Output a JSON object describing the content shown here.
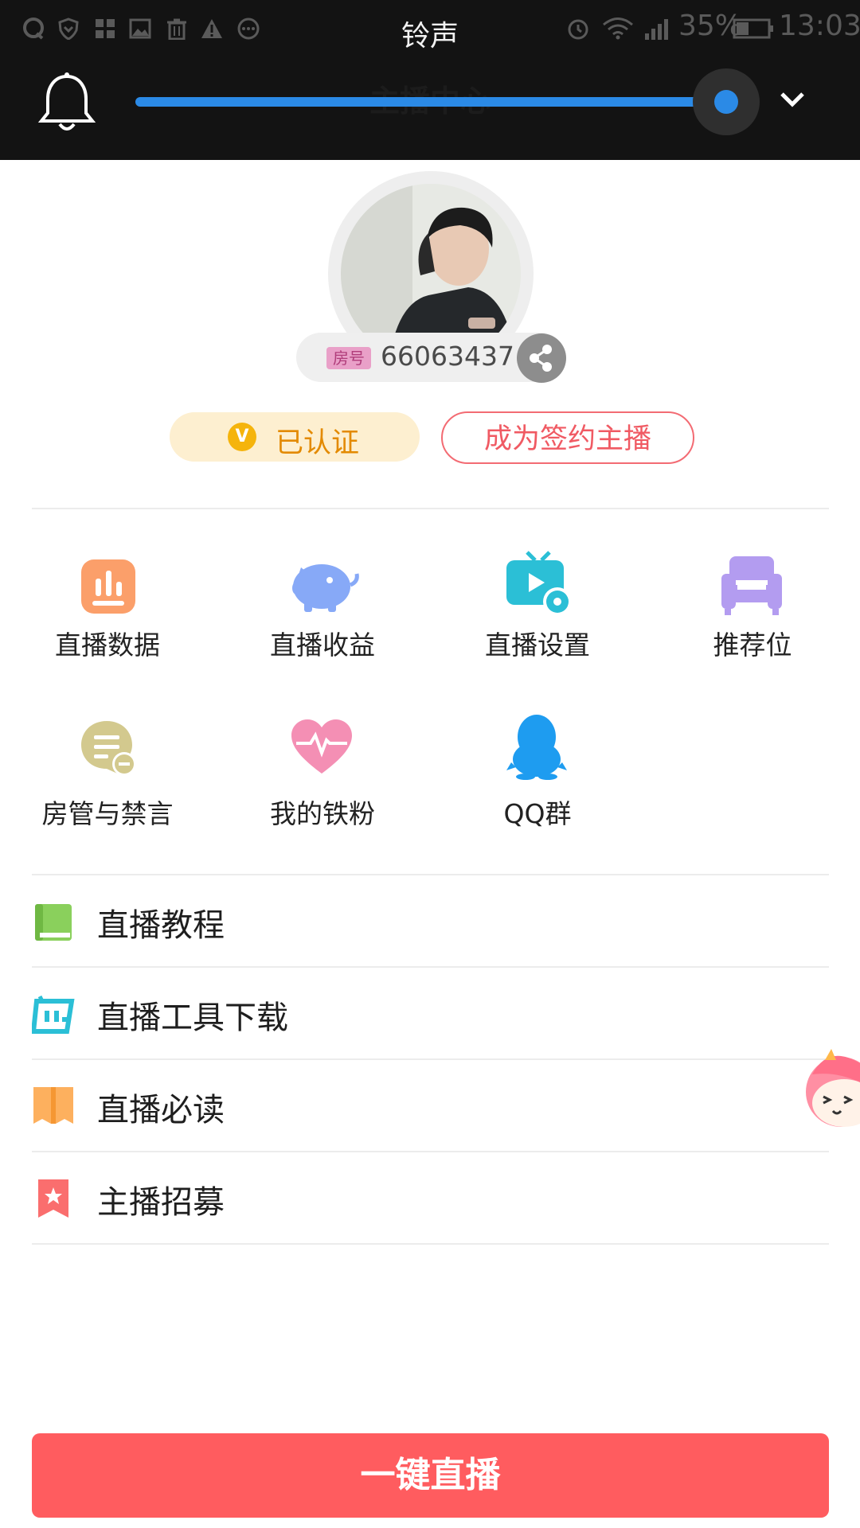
{
  "status_bar": {
    "title": "铃声",
    "battery": "35%",
    "time": "13:03",
    "icons": [
      "qq-icon",
      "shield-icon",
      "apps-icon",
      "image-icon",
      "trash-icon",
      "warning-icon",
      "more-icon",
      "alarm-icon",
      "wifi-icon",
      "signal-icon",
      "battery-icon"
    ]
  },
  "volume_overlay": {
    "icon": "bell-icon",
    "level_percent": 95,
    "accent": "#2b8ae6"
  },
  "header": {
    "title": "主播中心"
  },
  "profile": {
    "room_tag": "房号",
    "room_number": "66063437",
    "verified_label": "已认证",
    "verified_badge": "V",
    "sign_label": "成为签约主播"
  },
  "grid": [
    {
      "label": "直播数据",
      "icon": "chart-icon",
      "color": "#fb9f6a"
    },
    {
      "label": "直播收益",
      "icon": "piggy-bank-icon",
      "color": "#87a9f7"
    },
    {
      "label": "直播设置",
      "icon": "tv-settings-icon",
      "color": "#2bbfd6"
    },
    {
      "label": "推荐位",
      "icon": "sofa-icon",
      "color": "#b39cf0"
    },
    {
      "label": "房管与禁言",
      "icon": "chat-mute-icon",
      "color": "#d3c98e"
    },
    {
      "label": "我的铁粉",
      "icon": "heart-pulse-icon",
      "color": "#f48fb4"
    },
    {
      "label": "QQ群",
      "icon": "penguin-icon",
      "color": "#1e9cf0"
    }
  ],
  "list": [
    {
      "label": "直播教程",
      "icon": "book-icon",
      "color": "#8ad05c"
    },
    {
      "label": "直播工具下载",
      "icon": "tool-download-icon",
      "color": "#2bbfd6"
    },
    {
      "label": "直播必读",
      "icon": "open-book-icon",
      "color": "#fdb05e"
    },
    {
      "label": "主播招募",
      "icon": "bookmark-star-icon",
      "color": "#fa6e6e"
    }
  ],
  "cta": {
    "label": "一键直播",
    "color": "#ff5c5f"
  }
}
